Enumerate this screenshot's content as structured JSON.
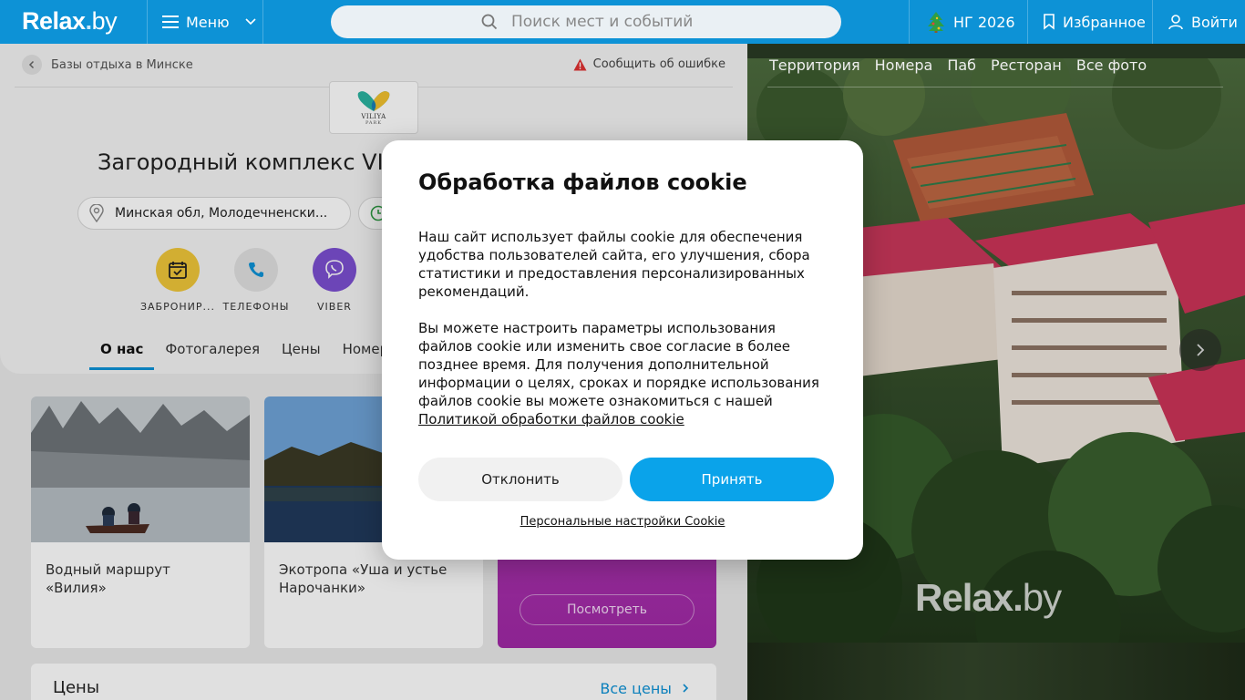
{
  "header": {
    "logo_main": "Relax",
    "logo_dot": ".",
    "logo_suffix": "by",
    "menu_label": "Меню",
    "search_placeholder": "Поиск мест и событий",
    "ny_label": "НГ 2026",
    "favorites_label": "Избранное",
    "login_label": "Войти"
  },
  "place": {
    "breadcrumb": "Базы отдыха в Минске",
    "report_error": "Сообщить об ошибке",
    "brand_name": "VILIYA",
    "brand_sub": "PARK",
    "title": "Загородный комплекс VI",
    "address": "Минская обл, Молодечненски...",
    "actions": [
      {
        "label": "ЗАБРОНИР..."
      },
      {
        "label": "ТЕЛЕФОНЫ"
      },
      {
        "label": "VIBER"
      }
    ],
    "tabs": [
      "О нас",
      "Фотогалерея",
      "Цены",
      "Номер"
    ],
    "cards": [
      {
        "title": "Водный маршрут «Вилия»"
      },
      {
        "title": "Экотропа «Уша и устье Нарочанки»"
      }
    ],
    "promo_button": "Посмотреть",
    "prices_title": "Цены",
    "all_prices": "Все цены"
  },
  "gallery": {
    "tabs": [
      "Территория",
      "Номера",
      "Паб",
      "Ресторан",
      "Все фото"
    ],
    "watermark_main": "Relax",
    "watermark_dot": ".",
    "watermark_suffix": "by"
  },
  "cookie_modal": {
    "title": "Обработка файлов cookie",
    "paragraph1": "Наш сайт использует файлы cookie для обеспечения удобства пользователей сайта, его улучшения, сбора статистики и предоставления персонализированных рекомендаций.",
    "paragraph2": "Вы можете настроить параметры использования файлов cookie или изменить свое согласие в более позднее время. Для получения дополнительной информации о целях, сроках и порядке использования файлов cookie вы можете ознакомиться с нашей",
    "policy_link": "Политикой обработки файлов cookie",
    "decline_label": "Отклонить",
    "accept_label": "Принять",
    "personal_settings": "Персональные настройки Cookie"
  },
  "colors": {
    "brand_blue": "#0d92d6",
    "accept_blue": "#0aa3ea",
    "promo_purple": "#a92fae",
    "book_yellow": "#f0c63a",
    "viber_purple": "#7b4fd1"
  }
}
